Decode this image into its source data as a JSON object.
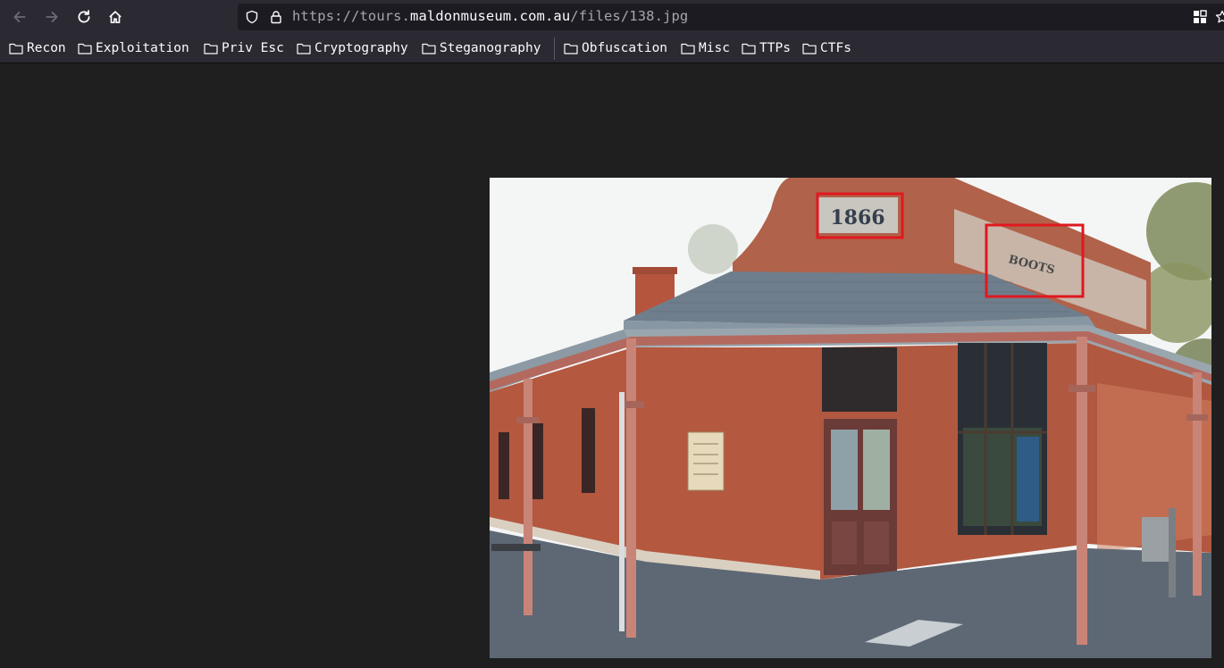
{
  "browser": {
    "url": {
      "prefix": "https://tours.",
      "host": "maldonmuseum.com.au",
      "path": "/files/138.jpg"
    },
    "bookmarks": [
      {
        "label": "Recon"
      },
      {
        "label": "Exploitation"
      },
      {
        "label": "Priv Esc"
      },
      {
        "label": "Cryptography"
      },
      {
        "label": "Steganography"
      },
      {
        "label": "Obfuscation"
      },
      {
        "label": "Misc"
      },
      {
        "label": "TTPs"
      },
      {
        "label": "CTFs"
      }
    ]
  },
  "photo": {
    "year_sign": "1866",
    "shop_sign": "BOOTS"
  },
  "colors": {
    "toolbar": "#2b2a33",
    "urlbar": "#1c1b22",
    "page_background": "#1f1f1f",
    "annotation_box": "#e0181f",
    "brick": "#b4583f"
  }
}
